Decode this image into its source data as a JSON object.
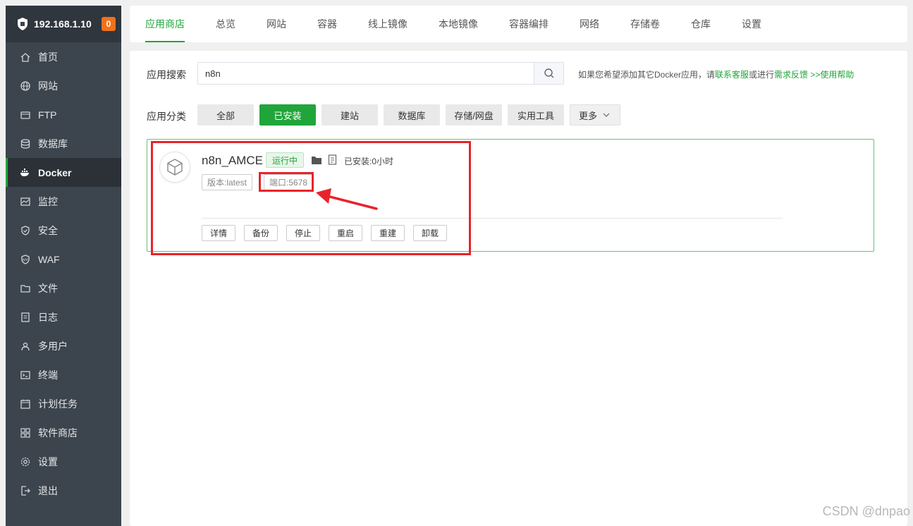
{
  "sidebar": {
    "server_ip": "192.168.1.10",
    "notification_count": "0",
    "items": [
      {
        "label": "首页",
        "icon": "home-icon"
      },
      {
        "label": "网站",
        "icon": "globe-icon"
      },
      {
        "label": "FTP",
        "icon": "ftp-icon"
      },
      {
        "label": "数据库",
        "icon": "database-icon"
      },
      {
        "label": "Docker",
        "icon": "docker-icon",
        "active": true
      },
      {
        "label": "监控",
        "icon": "monitor-icon"
      },
      {
        "label": "安全",
        "icon": "shield-icon"
      },
      {
        "label": "WAF",
        "icon": "waf-icon"
      },
      {
        "label": "文件",
        "icon": "folder-icon"
      },
      {
        "label": "日志",
        "icon": "log-icon"
      },
      {
        "label": "多用户",
        "icon": "users-icon"
      },
      {
        "label": "终端",
        "icon": "terminal-icon"
      },
      {
        "label": "计划任务",
        "icon": "calendar-icon"
      },
      {
        "label": "软件商店",
        "icon": "apps-grid-icon"
      },
      {
        "label": "设置",
        "icon": "gear-icon"
      },
      {
        "label": "退出",
        "icon": "logout-icon"
      }
    ]
  },
  "tabs": [
    "应用商店",
    "总览",
    "网站",
    "容器",
    "线上镜像",
    "本地镜像",
    "容器编排",
    "网络",
    "存储卷",
    "仓库",
    "设置"
  ],
  "active_tab": "应用商店",
  "search": {
    "label": "应用搜索",
    "value": "n8n",
    "hint_prefix": "如果您希望添加其它Docker应用，请",
    "hint_link1": "联系客服",
    "hint_mid": "或进行",
    "hint_link2": "需求反馈",
    "hint_link3": " >>使用帮助"
  },
  "categories": {
    "label": "应用分类",
    "items": [
      "全部",
      "已安装",
      "建站",
      "数据库",
      "存储/网盘",
      "实用工具"
    ],
    "active": "已安装",
    "more": "更多"
  },
  "app": {
    "name": "n8n_AMCE",
    "status": "运行中",
    "installed_time": "已安装:0小时",
    "version": "版本:latest",
    "port": "端口:5678",
    "actions": [
      "详情",
      "备份",
      "停止",
      "重启",
      "重建",
      "卸载"
    ]
  },
  "watermark": "CSDN @dnpao",
  "colors": {
    "accent": "#20a53a",
    "sidebar": "#3c444d",
    "annotation": "#e8232b",
    "badge": "#f0711a"
  }
}
